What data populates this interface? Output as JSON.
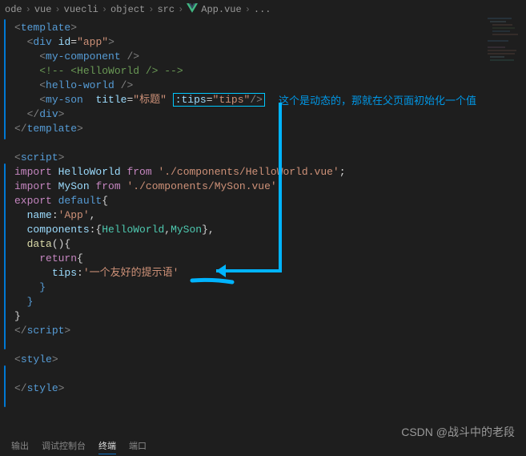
{
  "breadcrumb": {
    "parts": [
      "ode",
      "vue",
      "vuecli",
      "object",
      "src",
      "App.vue",
      "..."
    ]
  },
  "code": {
    "l1_open": "template",
    "l2_tag": "div",
    "l2_attr": "id",
    "l2_val": "\"app\"",
    "l3_tag": "my-component",
    "l4_comment": "<!-- <HelloWorld /> -->",
    "l5_tag": "hello-world",
    "l6_tag": "my-son",
    "l6_attr1": "title",
    "l6_val1": "\"标题\"",
    "l6_attr2": ":tips",
    "l6_val2": "\"tips\"",
    "l7_close": "div",
    "l8_close": "template",
    "l10_open": "script",
    "l11_kw": "import",
    "l11_var": "HelloWorld",
    "l11_from": "from",
    "l11_str": "'./components/HelloWorld.vue'",
    "l12_kw": "import",
    "l12_var": "MySon",
    "l12_from": "from",
    "l12_str": "'./components/MySon.vue'",
    "l13_kw": "export",
    "l13_kw2": "default",
    "l14_name": "name",
    "l14_val": "'App'",
    "l15_comp": "components",
    "l15_c1": "HelloWorld",
    "l15_c2": "MySon",
    "l16_data": "data",
    "l17_ret": "return",
    "l18_tips": "tips",
    "l18_val": "'一个友好的提示语'",
    "l22_close": "script",
    "l24_open": "style",
    "l26_close": "style"
  },
  "annotation": {
    "text": "这个是动态的，那就在父页面初始化一个值"
  },
  "watermark": "CSDN @战斗中的老段",
  "tabs": {
    "t1": "输出",
    "t2": "调试控制台",
    "t3": "终端",
    "t4": "端口"
  }
}
